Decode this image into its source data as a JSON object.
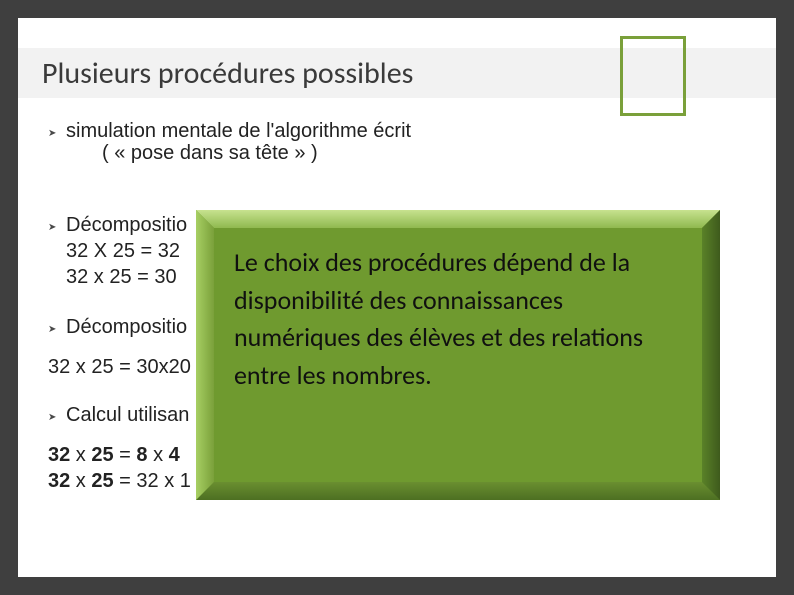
{
  "header": {
    "title": "Plusieurs procédures possibles"
  },
  "bullets": {
    "b1_line1": "simulation mentale de l'algorithme écrit",
    "b1_line2": "( « pose dans sa tête » )",
    "b2_line1": "Décompositio",
    "b2_line2_pre": "32 X 25 = 32",
    "b2_line3_pre": "32 x 25 = 30",
    "b3_line1": "Décompositio",
    "b3_line2_pre": "32 x 25 = 30x20",
    "b4_line1": "Calcul utilisan",
    "b4_line2_a": "32",
    "b4_line2_b": " x ",
    "b4_line2_c": "25",
    "b4_line2_d": " = ",
    "b4_line2_e": "8",
    "b4_line2_f": " x ",
    "b4_line2_g": "4",
    "b4_line3_a": "32",
    "b4_line3_b": " x ",
    "b4_line3_c": "25",
    "b4_line3_d": " = 32 x 1"
  },
  "overlay": {
    "text": "Le choix des procédures dépend de la disponibilité des connaissances numériques des élèves et des relations entre les nombres."
  }
}
